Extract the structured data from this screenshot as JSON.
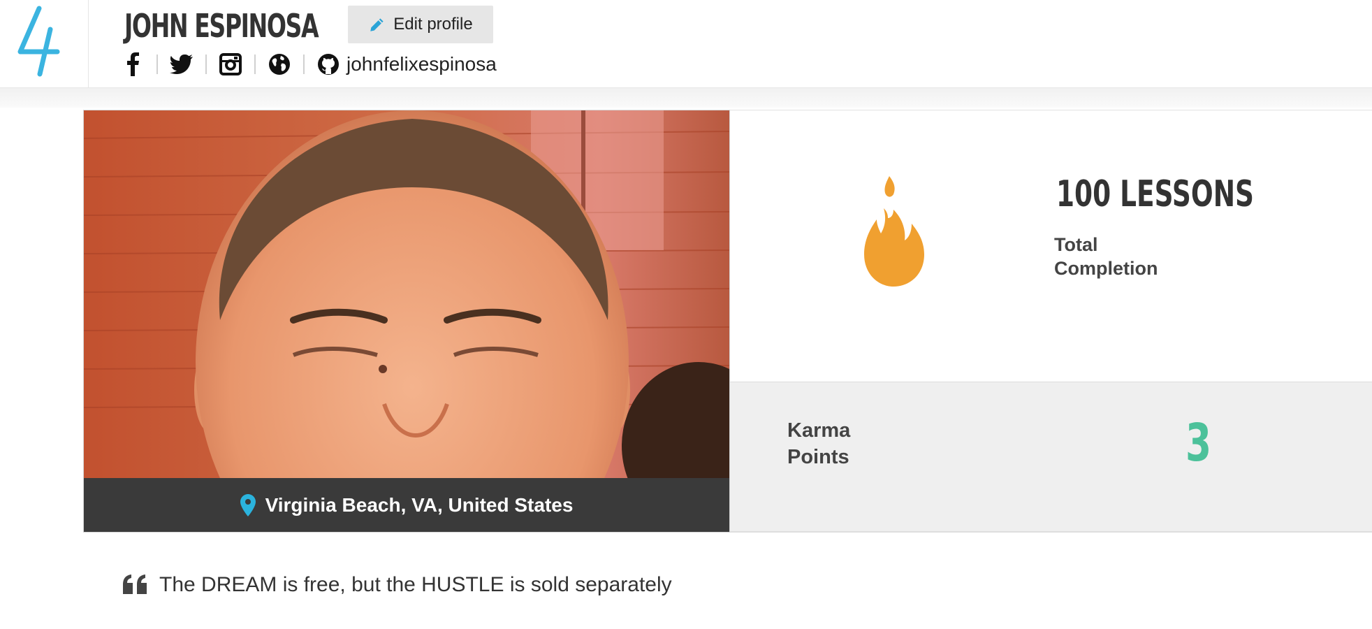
{
  "header": {
    "logo_icon": "lightning-bolt-logo-icon",
    "name": "JOHN ESPINOSA",
    "edit_button": {
      "label": "Edit profile",
      "icon": "pencil-icon"
    },
    "social": {
      "icons": [
        "facebook-icon",
        "twitter-icon",
        "instagram-icon",
        "globe-icon",
        "github-icon"
      ],
      "github_handle": "johnfelixespinosa"
    }
  },
  "profile": {
    "photo": "profile-photo",
    "location": "Virginia Beach, VA, United States"
  },
  "stats": {
    "lessons_value": "100 LESSONS",
    "lessons_label": "Total Completion",
    "karma_label": "Karma Points",
    "karma_value": "3"
  },
  "quote": "The DREAM is free, but the HUSTLE is sold separately",
  "colors": {
    "brand_blue": "#3bb4e0",
    "fire_orange": "#f0a030",
    "karma_green": "#4cc19a",
    "location_bar": "#3a3a3a",
    "pin_blue": "#2bb3dd"
  }
}
